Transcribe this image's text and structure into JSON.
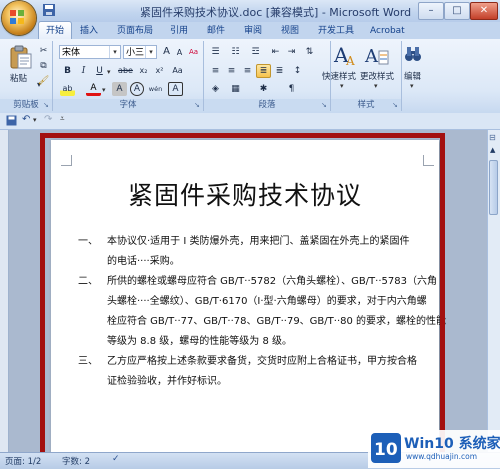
{
  "window": {
    "title": "紧固件采购技术协议.doc [兼容模式] - Microsoft Word",
    "minimize": "–",
    "maximize": "□",
    "close": "✕"
  },
  "tabs": [
    {
      "label": "开始",
      "active": true
    },
    {
      "label": "插入"
    },
    {
      "label": "页面布局"
    },
    {
      "label": "引用"
    },
    {
      "label": "邮件"
    },
    {
      "label": "审阅"
    },
    {
      "label": "视图"
    },
    {
      "label": "开发工具"
    },
    {
      "label": "Acrobat"
    }
  ],
  "ribbon": {
    "clipboard": {
      "group_label": "剪贴板",
      "paste_label": "粘贴"
    },
    "font": {
      "group_label": "字体",
      "font_name": "宋体",
      "font_size": "小三",
      "grow": "A",
      "shrink": "A",
      "clear": "Aa",
      "wen": "wén",
      "ann": "A",
      "bold": "B",
      "italic": "I",
      "underline": "U",
      "strike": "abe",
      "sub": "x₂",
      "sup": "x²",
      "aa": "Aa",
      "highlight": "ab",
      "color_a": "A",
      "char_a": "A",
      "circle_a": "A"
    },
    "paragraph": {
      "group_label": "段落"
    },
    "styles": {
      "group_label": "样式",
      "quick_styles": "快速样式",
      "change_styles": "更改样式"
    },
    "editing": {
      "label": "编辑",
      "icon": "binoculars-icon"
    }
  },
  "document": {
    "title": "紧固件采购技术协议",
    "paragraphs": [
      {
        "num": "一、",
        "lines": [
          "本协议仅·适用于 I 类防爆外壳，用来把门、盖紧固在外壳上的紧固件",
          "的电话····采购。"
        ]
      },
      {
        "num": "二、",
        "lines": [
          "所供的螺栓或螺母应符合 GB/T··5782（六角头螺栓）、GB/T··5783（六角",
          "头螺栓····全螺纹）、GB/T·6170（I·型·六角螺母）的要求，对于内六角螺",
          "栓应符合 GB/T··77、GB/T··78、GB/T··79、GB/T··80 的要求，螺栓的性能",
          "等级为 8.8 级，螺母的性能等级为 8 级。"
        ]
      },
      {
        "num": "三、",
        "lines": [
          "乙方应严格按上述条款要求备货，交货时应附上合格证书，甲方按合格",
          "证检验验收，并作好标识。"
        ]
      }
    ]
  },
  "status": {
    "page": "页面: 1/2",
    "words": "字数: 2"
  },
  "watermark": {
    "brand": "Win10 系统家园",
    "url": "www.qdhuajin.com"
  },
  "colors": {
    "highlight_border": "#a3100f",
    "accent": "#15428b"
  }
}
